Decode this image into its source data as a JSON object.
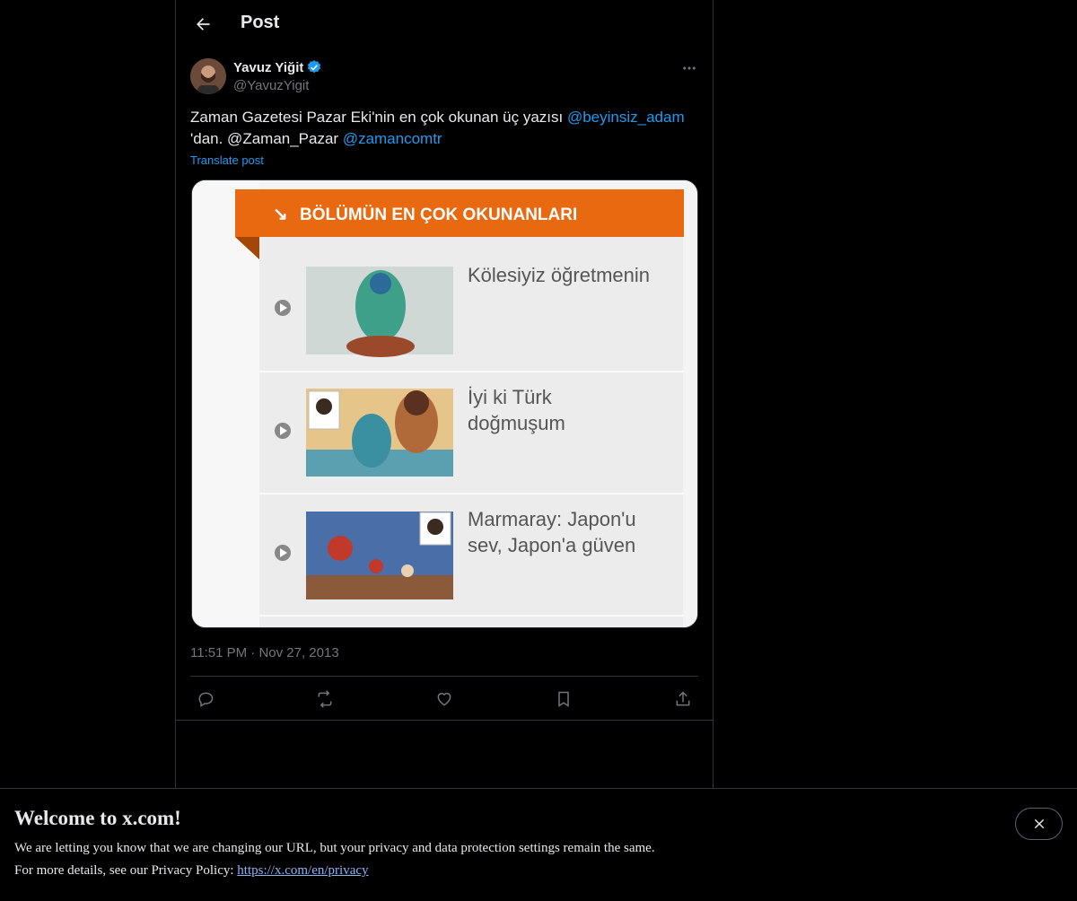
{
  "header": {
    "title": "Post"
  },
  "author": {
    "name": "Yavuz Yiğit",
    "handle": "@YavuzYigit"
  },
  "post": {
    "text_part1": "Zaman Gazetesi Pazar Eki'nin en çok okunan üç yazısı ",
    "mention1": "@beyinsiz_adam",
    "text_part2": "'dan. @Zaman_Pazar ",
    "mention2": "@zamancomtr",
    "translate_label": "Translate post",
    "time": "11:51 PM",
    "separator": "·",
    "date": "Nov 27, 2013"
  },
  "media": {
    "banner_text": "BÖLÜMÜN EN ÇOK OKUNANLARI",
    "items": [
      {
        "title_line1": "Kölesiyiz öğretmenin",
        "title_line2": ""
      },
      {
        "title_line1": "İyi ki Türk",
        "title_line2": "doğmuşum"
      },
      {
        "title_line1": "Marmaray: Japon'u",
        "title_line2": "sev, Japon'a güven"
      }
    ]
  },
  "actions": [
    {
      "icon": "reply-icon"
    },
    {
      "icon": "repost-icon"
    },
    {
      "icon": "like-icon"
    },
    {
      "icon": "bookmark-icon"
    },
    {
      "icon": "share-icon"
    }
  ],
  "banner": {
    "title": "Welcome to x.com!",
    "line1": "We are letting you know that we are changing our URL, but your privacy and data protection settings remain the same.",
    "line2_prefix": "For more details, see our Privacy Policy: ",
    "link": "https://x.com/en/privacy"
  },
  "colors": {
    "accent": "#1d9bf0",
    "orange_banner": "#e8690f",
    "verified": "#1d9bf0"
  }
}
